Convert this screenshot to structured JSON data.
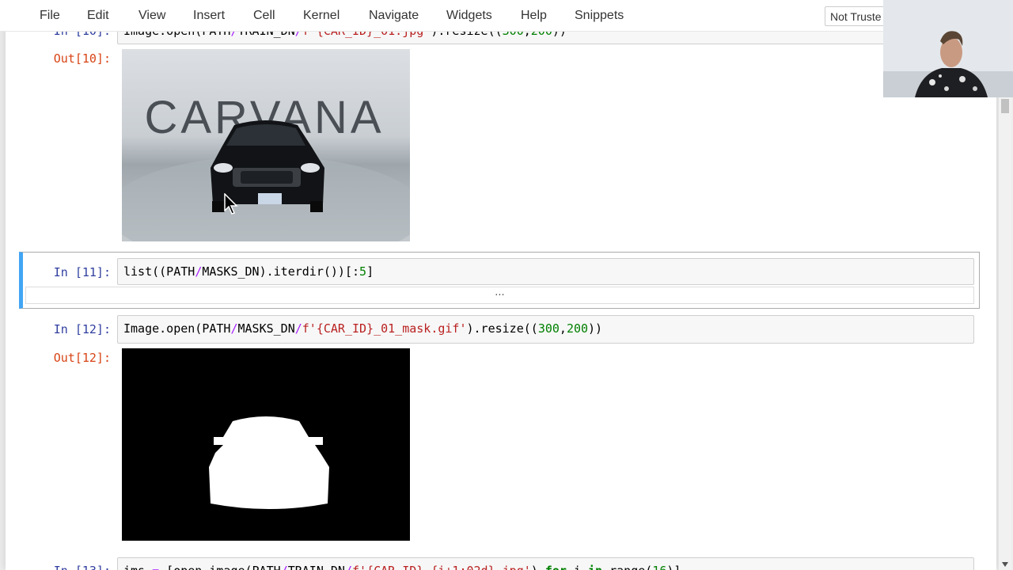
{
  "menubar": {
    "items": [
      "File",
      "Edit",
      "View",
      "Insert",
      "Cell",
      "Kernel",
      "Navigate",
      "Widgets",
      "Help",
      "Snippets"
    ],
    "trust_label": "Not Truste"
  },
  "cells": {
    "c10": {
      "in_prompt": "In [10]:",
      "out_prompt": "Out[10]:",
      "image_text": "CARVANA"
    },
    "c11": {
      "in_prompt": "In [11]:",
      "collapsed": "..."
    },
    "c12": {
      "in_prompt": "In [12]:",
      "out_prompt": "Out[12]:"
    },
    "c13": {
      "in_prompt": "In [13]:"
    }
  },
  "colors": {
    "selected_bar": "#42a5f5",
    "in_prompt": "#303f9f",
    "out_prompt": "#d84315"
  }
}
